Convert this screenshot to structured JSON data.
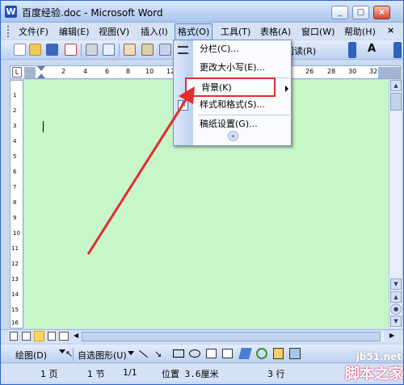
{
  "window": {
    "title": "百度经验.doc - Microsoft Word",
    "app_icon": "W"
  },
  "menubar": [
    "文件(F)",
    "编辑(E)",
    "视图(V)",
    "插入(I)",
    "格式(O)",
    "工具(T)",
    "表格(A)",
    "窗口(W)",
    "帮助(H)"
  ],
  "menubar_close": "×",
  "toolbar": {
    "read_label": "阅读(R)",
    "font_glyph": "A"
  },
  "ruler_numbers": [
    "2",
    "4",
    "6",
    "8",
    "10",
    "12",
    "26",
    "28",
    "30",
    "32"
  ],
  "vertical_ruler_numbers": [
    "1",
    "2",
    "3",
    "4",
    "5",
    "6",
    "7",
    "8",
    "9",
    "10",
    "11",
    "12",
    "13",
    "14",
    "15",
    "16"
  ],
  "format_menu": {
    "items": [
      {
        "label": "分栏(C)..."
      },
      {
        "label": "更改大小写(E)..."
      },
      {
        "label": "背景(K)",
        "submenu": true
      },
      {
        "label": "样式和格式(S)..."
      },
      {
        "label": "稿纸设置(G)..."
      }
    ],
    "expand_glyph": "»"
  },
  "drawing_toolbar": {
    "draw_label": "绘图(D)",
    "autoshape_label": "自选图形(U)"
  },
  "status": {
    "page": "1 页",
    "section": "1 节",
    "page_count": "1/1",
    "position": "位置 3.6厘米",
    "line": "3 行"
  },
  "watermark": {
    "line1": "jb51.net",
    "line2": "脚本之家"
  },
  "colors": {
    "document_bg": "#c7f7c8",
    "highlight_border": "#e32c2c",
    "arrow": "#e32c2c"
  }
}
